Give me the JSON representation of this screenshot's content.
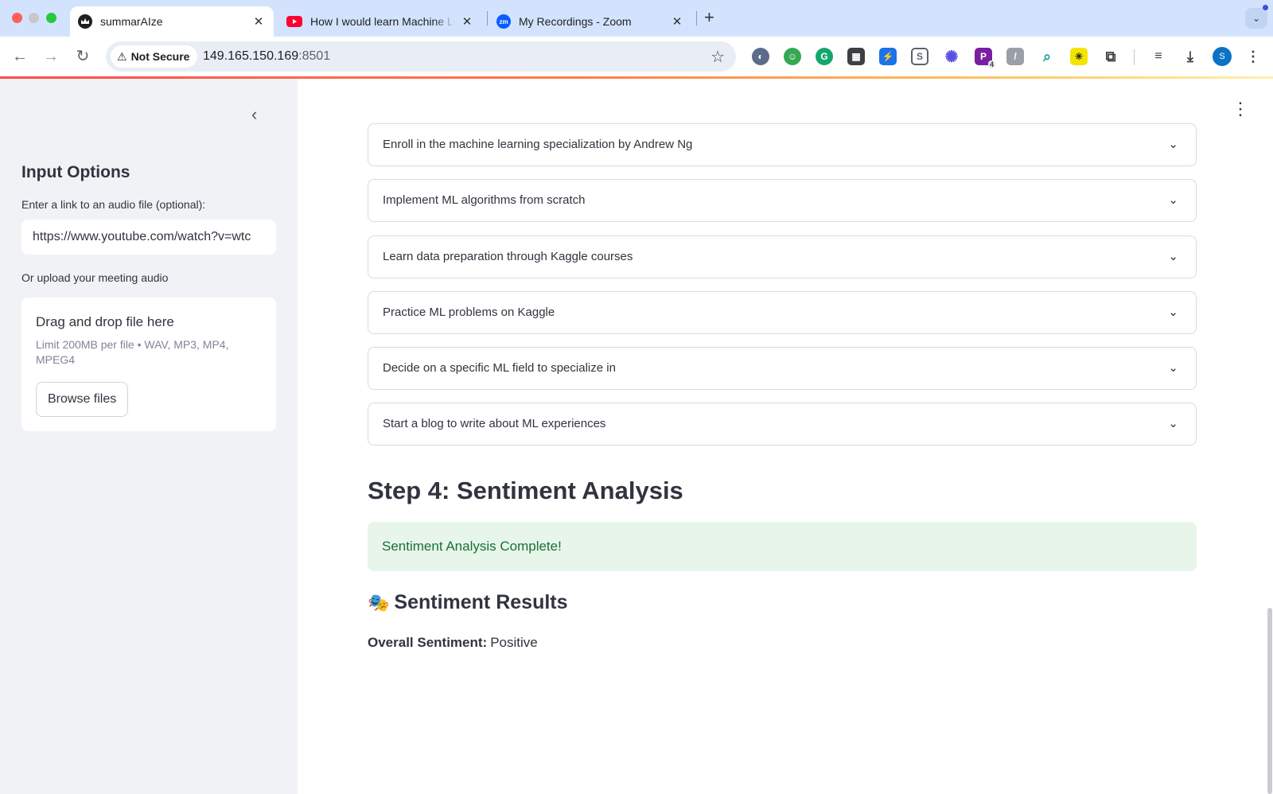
{
  "browser": {
    "tabs": [
      {
        "title": "summarAIze",
        "active": true,
        "favicon": "streamlit-crown-icon"
      },
      {
        "title": "How I would learn Machine Le",
        "active": false,
        "favicon": "youtube-icon"
      },
      {
        "title": "My Recordings - Zoom",
        "active": false,
        "favicon": "zoom-icon"
      }
    ],
    "security_label": "Not Secure",
    "url_host": "149.165.150.169",
    "url_port": ":8501",
    "profile_initial": "S",
    "extension_badge": "4"
  },
  "sidebar": {
    "title": "Input Options",
    "link_label": "Enter a link to an audio file (optional):",
    "link_value": "https://www.youtube.com/watch?v=wtc",
    "upload_label": "Or upload your meeting audio",
    "dropzone_title": "Drag and drop file here",
    "dropzone_limit": "Limit 200MB per file • WAV, MP3, MP4, MPEG4",
    "browse_label": "Browse files"
  },
  "main": {
    "expanders": [
      "Enroll in the machine learning specialization by Andrew Ng",
      "Implement ML algorithms from scratch",
      "Learn data preparation through Kaggle courses",
      "Practice ML problems on Kaggle",
      "Decide on a specific ML field to specialize in",
      "Start a blog to write about ML experiences"
    ],
    "step_heading": "Step 4: Sentiment Analysis",
    "success_message": "Sentiment Analysis Complete!",
    "results_heading": "Sentiment Results",
    "results_emoji": "🎭",
    "overall_label": "Overall Sentiment:",
    "overall_value": "Positive"
  },
  "colors": {
    "tabstrip_bg": "#d3e3fd",
    "sidebar_bg": "#f0f2f6",
    "success_bg": "#e8f5ea",
    "success_text": "#177233",
    "accent_red": "#ff4b4b"
  }
}
